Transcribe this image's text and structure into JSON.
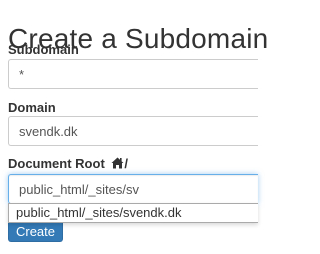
{
  "page": {
    "title": "Create a Subdomain"
  },
  "subdomain": {
    "label": "Subdomain",
    "value": "*"
  },
  "domain": {
    "label": "Domain",
    "value": "svendk.dk"
  },
  "document_root": {
    "label": "Document Root",
    "icon": "home-icon",
    "suffix": "/",
    "value": "public_html/_sites/sv",
    "suggestions": [
      "public_html/_sites/svendk.dk"
    ]
  },
  "actions": {
    "create_label": "Create"
  },
  "colors": {
    "button": "#337ab7",
    "focus_border": "#66afe9",
    "text": "#333333"
  }
}
